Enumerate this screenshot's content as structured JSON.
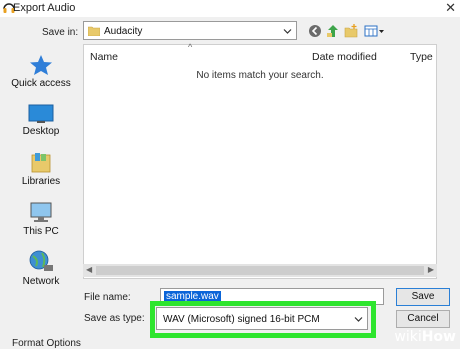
{
  "window": {
    "title": "Export Audio"
  },
  "save_in": {
    "label": "Save in:",
    "value": "Audacity"
  },
  "columns": [
    "Name",
    "Date modified",
    "Type"
  ],
  "empty_message": "No items match your search.",
  "sidebar": {
    "items": [
      {
        "label": "Quick access",
        "icon": "star-icon"
      },
      {
        "label": "Desktop",
        "icon": "desktop-icon"
      },
      {
        "label": "Libraries",
        "icon": "libraries-icon"
      },
      {
        "label": "This PC",
        "icon": "computer-icon"
      },
      {
        "label": "Network",
        "icon": "network-icon"
      }
    ]
  },
  "file_name": {
    "label": "File name:",
    "value": "sample.wav"
  },
  "save_as_type": {
    "label": "Save as type:",
    "value": "WAV (Microsoft) signed 16-bit PCM"
  },
  "buttons": {
    "save": "Save",
    "cancel": "Cancel"
  },
  "footer": {
    "format_options": "Format Options"
  },
  "watermark": {
    "prefix": "wiki",
    "suffix": "How"
  },
  "colors": {
    "highlight": "#2ee52e",
    "selection": "#0a64d8"
  }
}
